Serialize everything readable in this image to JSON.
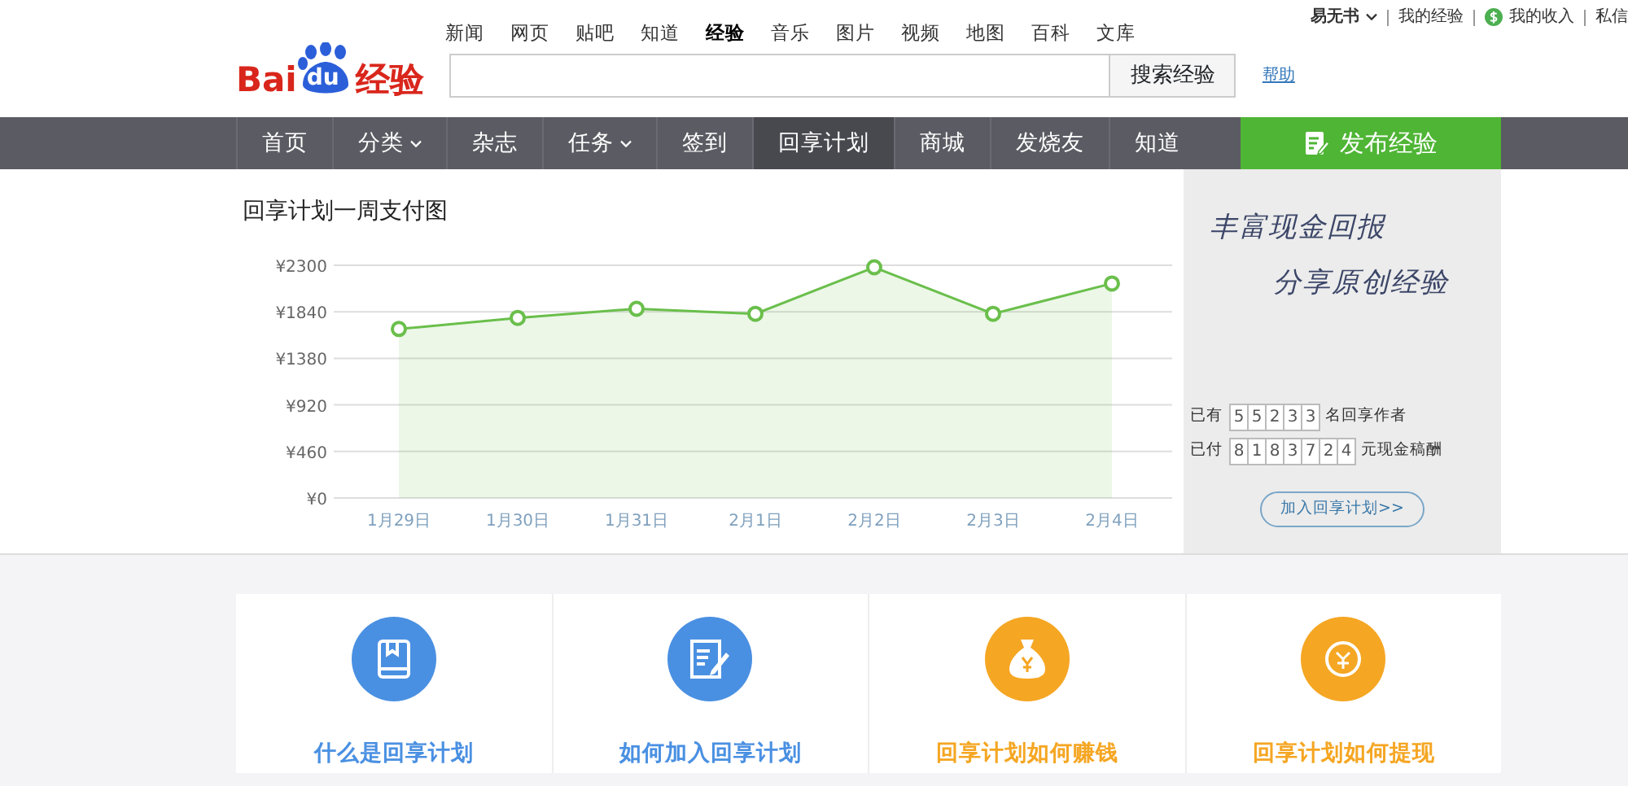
{
  "header": {
    "logo": {
      "left": "Bai",
      "paw": "du",
      "right": "经验"
    },
    "channels": [
      {
        "label": "新闻",
        "selected": false
      },
      {
        "label": "网页",
        "selected": false
      },
      {
        "label": "贴吧",
        "selected": false
      },
      {
        "label": "知道",
        "selected": false
      },
      {
        "label": "经验",
        "selected": true
      },
      {
        "label": "音乐",
        "selected": false
      },
      {
        "label": "图片",
        "selected": false
      },
      {
        "label": "视频",
        "selected": false
      },
      {
        "label": "地图",
        "selected": false
      },
      {
        "label": "百科",
        "selected": false
      },
      {
        "label": "文库",
        "selected": false
      }
    ],
    "search_button": "搜索经验",
    "help_link": "帮助",
    "user_menu": {
      "user": "易无书",
      "links": [
        "我的经验",
        "我的收入",
        "私信"
      ]
    }
  },
  "nav": {
    "items": [
      {
        "label": "首页",
        "dropdown": false,
        "selected": false
      },
      {
        "label": "分类",
        "dropdown": true,
        "selected": false
      },
      {
        "label": "杂志",
        "dropdown": false,
        "selected": false
      },
      {
        "label": "任务",
        "dropdown": true,
        "selected": false
      },
      {
        "label": "签到",
        "dropdown": false,
        "selected": false
      },
      {
        "label": "回享计划",
        "dropdown": false,
        "selected": true
      },
      {
        "label": "商城",
        "dropdown": false,
        "selected": false
      },
      {
        "label": "发烧友",
        "dropdown": false,
        "selected": false
      },
      {
        "label": "知道",
        "dropdown": false,
        "selected": false
      }
    ],
    "publish_button": "发布经验"
  },
  "chart_panel": {
    "title": "回享计划一周支付图",
    "chart_data": {
      "type": "area",
      "categories": [
        "1月29日",
        "1月30日",
        "1月31日",
        "2月1日",
        "2月2日",
        "2月3日",
        "2月4日"
      ],
      "series": [
        {
          "color": "#6abf4b",
          "values": [
            1670,
            1780,
            1870,
            1820,
            2280,
            1820,
            2120
          ]
        }
      ],
      "grid": true,
      "ylim": [
        0,
        2300
      ],
      "yticks": [
        {
          "value": 0,
          "label": "¥0"
        },
        {
          "value": 460,
          "label": "¥460"
        },
        {
          "value": 920,
          "label": "¥920"
        },
        {
          "value": 1380,
          "label": "¥1380"
        },
        {
          "value": 1840,
          "label": "¥1840"
        },
        {
          "value": 2300,
          "label": "¥2300"
        }
      ]
    }
  },
  "promo": {
    "slogan_1": "丰富现金回报",
    "slogan_2": "分享原创经验",
    "counters": [
      {
        "prefix": "已有",
        "digits": [
          "5",
          "5",
          "2",
          "3",
          "3"
        ],
        "suffix": "名回享作者"
      },
      {
        "prefix": "已付",
        "digits": [
          "8",
          "1",
          "8",
          "3",
          "7",
          "2",
          "4"
        ],
        "suffix": "元现金稿酬"
      }
    ],
    "join_button": "加入回享计划>>"
  },
  "features": [
    {
      "kind": "book",
      "title": "什么是回享计划",
      "color": "#4a90e2"
    },
    {
      "kind": "edit",
      "title": "如何加入回享计划",
      "color": "#4a90e2"
    },
    {
      "kind": "moneybag",
      "title": "回享计划如何赚钱",
      "color": "#f5a623"
    },
    {
      "kind": "coin",
      "title": "回享计划如何提现",
      "color": "#f5a623"
    }
  ]
}
